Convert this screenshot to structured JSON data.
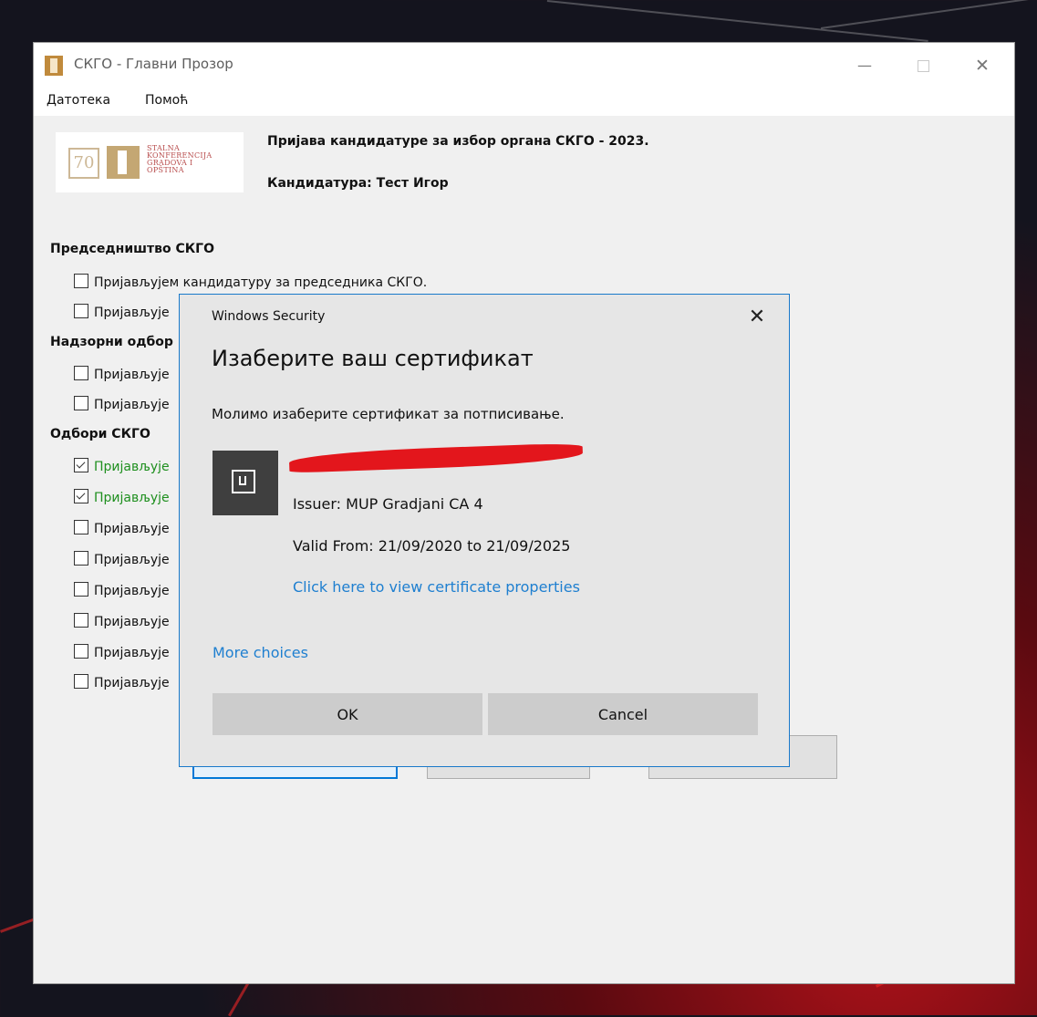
{
  "window": {
    "title": "СКГО - Главни Прозор",
    "minimize_glyph": "—",
    "close_glyph": "✕"
  },
  "menu": {
    "file": "Датотека",
    "help": "Помоћ"
  },
  "logo": {
    "mark": "70",
    "lines": [
      "STALNA",
      "KONFERENCIJA",
      "GRADOVA I",
      "OPŠTINA"
    ]
  },
  "header": {
    "title": "Пријава кандидатуре за избор органа СКГО - 2023.",
    "candidate": "Кандидатура: Тест Игор"
  },
  "sections": [
    {
      "title": "Председништво СКГО",
      "items": [
        {
          "label": "Пријављујем кандидатуру за председника СКГО.",
          "checked": false
        },
        {
          "label": "Пријављује",
          "checked": false
        }
      ]
    },
    {
      "title": "Надзорни одбор",
      "items": [
        {
          "label": "Пријављује",
          "checked": false
        },
        {
          "label": "Пријављује",
          "checked": false
        }
      ]
    },
    {
      "title": "Одбори СКГО",
      "items": [
        {
          "label": "Пријављује",
          "checked": true
        },
        {
          "label": "Пријављује",
          "checked": true
        },
        {
          "label": "Пријављује",
          "checked": false
        },
        {
          "label": "Пријављује",
          "checked": false
        },
        {
          "label": "Пријављује",
          "checked": false
        },
        {
          "label": "Пријављује",
          "checked": false
        },
        {
          "label": "Пријављује",
          "checked": false
        },
        {
          "label": "Пријављује",
          "checked": false
        }
      ]
    }
  ],
  "dialog": {
    "caption": "Windows Security",
    "close_glyph": "✕",
    "heading": "Изаберите ваш сертификат",
    "description": "Молимо изаберите сертификат за потписивање.",
    "certificate": {
      "icon": "certificate-icon",
      "name": "",
      "issuer": "Issuer: MUP Gradjani CA 4",
      "valid": "Valid From: 21/09/2020 to 21/09/2025",
      "properties_link": "Click here to view certificate properties"
    },
    "more_choices": "More choices",
    "ok": "OK",
    "cancel": "Cancel"
  },
  "colors": {
    "link": "#1e7fd0",
    "checked_text": "#1e8f1e",
    "dialog_border": "#1979ca",
    "redaction": "#e3161c"
  }
}
